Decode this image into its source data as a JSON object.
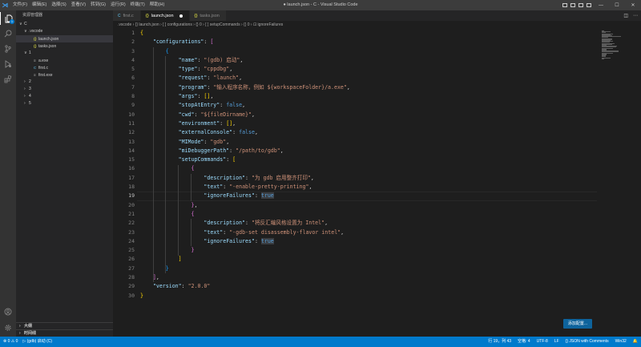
{
  "window": {
    "logo": "⋊",
    "title": "● launch.json - C - Visual Studio Code",
    "menu": [
      "文件(F)",
      "编辑(E)",
      "选择(S)",
      "查看(V)",
      "转到(G)",
      "运行(R)",
      "终端(T)",
      "帮助(H)"
    ],
    "controls": {
      "minimize": "—",
      "maximize": "☐",
      "close": "✕"
    }
  },
  "activity_bar": {
    "items": [
      "explorer-icon",
      "search-icon",
      "source-control-icon",
      "run-debug-icon",
      "extensions-icon"
    ],
    "badge": "1",
    "bottom": [
      "account-icon",
      "settings-icon"
    ]
  },
  "sidebar": {
    "title": "资源管理器",
    "tree": [
      {
        "label": "C",
        "chevron": "∨",
        "indent": 0,
        "icon": ""
      },
      {
        "label": ".vscode",
        "chevron": "∨",
        "indent": 1,
        "icon": ""
      },
      {
        "label": "launch.json",
        "chevron": "",
        "indent": 2,
        "icon": "{}",
        "selected": true
      },
      {
        "label": "tasks.json",
        "chevron": "",
        "indent": 2,
        "icon": "{}"
      },
      {
        "label": "1",
        "chevron": "∨",
        "indent": 1,
        "icon": ""
      },
      {
        "label": "a.exe",
        "chevron": "",
        "indent": 2,
        "icon": "≡"
      },
      {
        "label": "first.c",
        "chevron": "",
        "indent": 2,
        "icon": "C"
      },
      {
        "label": "first.exe",
        "chevron": "",
        "indent": 2,
        "icon": "≡"
      },
      {
        "label": "2",
        "chevron": "›",
        "indent": 1,
        "icon": ""
      },
      {
        "label": "3",
        "chevron": "›",
        "indent": 1,
        "icon": ""
      },
      {
        "label": "4",
        "chevron": "›",
        "indent": 1,
        "icon": ""
      },
      {
        "label": "5",
        "chevron": "›",
        "indent": 1,
        "icon": ""
      }
    ],
    "sections": [
      "大纲",
      "时间线"
    ]
  },
  "tabs": [
    {
      "label": "first.c",
      "icon": "C",
      "active": false
    },
    {
      "label": "launch.json",
      "icon": "{}",
      "active": true,
      "modified": true
    },
    {
      "label": "tasks.json",
      "icon": "{}",
      "active": false
    }
  ],
  "breadcrumb": ".vscode  ›  {} launch.json  ›  [ ] configurations  ›  {} 0  ›  [ ] setupCommands  ›  {} 0  ›  ⊡ ignoreFailures",
  "editor": {
    "current_line": 19,
    "lines": [
      [
        [
          "br1",
          "{"
        ]
      ],
      [
        [
          "p",
          "    "
        ],
        [
          "k",
          "\"configurations\""
        ],
        [
          "p",
          ": "
        ],
        [
          "br2",
          "["
        ]
      ],
      [
        [
          "p",
          "        "
        ],
        [
          "br3",
          "{"
        ]
      ],
      [
        [
          "p",
          "            "
        ],
        [
          "k",
          "\"name\""
        ],
        [
          "p",
          ": "
        ],
        [
          "s",
          "\"(gdb) 启动\""
        ],
        [
          "p",
          ","
        ]
      ],
      [
        [
          "p",
          "            "
        ],
        [
          "k",
          "\"type\""
        ],
        [
          "p",
          ": "
        ],
        [
          "s",
          "\"cppdbg\""
        ],
        [
          "p",
          ","
        ]
      ],
      [
        [
          "p",
          "            "
        ],
        [
          "k",
          "\"request\""
        ],
        [
          "p",
          ": "
        ],
        [
          "s",
          "\"launch\""
        ],
        [
          "p",
          ","
        ]
      ],
      [
        [
          "p",
          "            "
        ],
        [
          "k",
          "\"program\""
        ],
        [
          "p",
          ": "
        ],
        [
          "s",
          "\"输入程序名称，例如 ${workspaceFolder}/a.exe\""
        ],
        [
          "p",
          ","
        ]
      ],
      [
        [
          "p",
          "            "
        ],
        [
          "k",
          "\"args\""
        ],
        [
          "p",
          ": "
        ],
        [
          "br1",
          "[]"
        ],
        [
          "p",
          ","
        ]
      ],
      [
        [
          "p",
          "            "
        ],
        [
          "k",
          "\"stopAtEntry\""
        ],
        [
          "p",
          ": "
        ],
        [
          "b",
          "false"
        ],
        [
          "p",
          ","
        ]
      ],
      [
        [
          "p",
          "            "
        ],
        [
          "k",
          "\"cwd\""
        ],
        [
          "p",
          ": "
        ],
        [
          "s",
          "\"${fileDirname}\""
        ],
        [
          "p",
          ","
        ]
      ],
      [
        [
          "p",
          "            "
        ],
        [
          "k",
          "\"environment\""
        ],
        [
          "p",
          ": "
        ],
        [
          "br1",
          "[]"
        ],
        [
          "p",
          ","
        ]
      ],
      [
        [
          "p",
          "            "
        ],
        [
          "k",
          "\"externalConsole\""
        ],
        [
          "p",
          ": "
        ],
        [
          "b",
          "false"
        ],
        [
          "p",
          ","
        ]
      ],
      [
        [
          "p",
          "            "
        ],
        [
          "k",
          "\"MIMode\""
        ],
        [
          "p",
          ": "
        ],
        [
          "s",
          "\"gdb\""
        ],
        [
          "p",
          ","
        ]
      ],
      [
        [
          "p",
          "            "
        ],
        [
          "k",
          "\"miDebuggerPath\""
        ],
        [
          "p",
          ": "
        ],
        [
          "s",
          "\"/path/to/gdb\""
        ],
        [
          "p",
          ","
        ]
      ],
      [
        [
          "p",
          "            "
        ],
        [
          "k",
          "\"setupCommands\""
        ],
        [
          "p",
          ": "
        ],
        [
          "br1",
          "["
        ]
      ],
      [
        [
          "p",
          "                "
        ],
        [
          "br2",
          "{"
        ]
      ],
      [
        [
          "p",
          "                    "
        ],
        [
          "k",
          "\"description\""
        ],
        [
          "p",
          ": "
        ],
        [
          "s",
          "\"为 gdb 启用整齐打印\""
        ],
        [
          "p",
          ","
        ]
      ],
      [
        [
          "p",
          "                    "
        ],
        [
          "k",
          "\"text\""
        ],
        [
          "p",
          ": "
        ],
        [
          "s",
          "\"-enable-pretty-printing\""
        ],
        [
          "p",
          ","
        ]
      ],
      [
        [
          "p",
          "                    "
        ],
        [
          "k",
          "\"ignoreFailures\""
        ],
        [
          "p",
          ": "
        ],
        [
          "b",
          "true"
        ]
      ],
      [
        [
          "p",
          "                "
        ],
        [
          "br2",
          "}"
        ],
        [
          "p",
          ","
        ]
      ],
      [
        [
          "p",
          "                "
        ],
        [
          "br2",
          "{"
        ]
      ],
      [
        [
          "p",
          "                    "
        ],
        [
          "k",
          "\"description\""
        ],
        [
          "p",
          ": "
        ],
        [
          "s",
          "\"将反汇编风格设置为 Intel\""
        ],
        [
          "p",
          ","
        ]
      ],
      [
        [
          "p",
          "                    "
        ],
        [
          "k",
          "\"text\""
        ],
        [
          "p",
          ": "
        ],
        [
          "s",
          "\"-gdb-set disassembly-flavor intel\""
        ],
        [
          "p",
          ","
        ]
      ],
      [
        [
          "p",
          "                    "
        ],
        [
          "k",
          "\"ignoreFailures\""
        ],
        [
          "p",
          ": "
        ],
        [
          "b",
          "true"
        ]
      ],
      [
        [
          "p",
          "                "
        ],
        [
          "br2",
          "}"
        ]
      ],
      [
        [
          "p",
          "            "
        ],
        [
          "br1",
          "]"
        ]
      ],
      [
        [
          "p",
          "        "
        ],
        [
          "br3",
          "}"
        ]
      ],
      [
        [
          "p",
          "    "
        ],
        [
          "br2",
          "]"
        ],
        [
          "p",
          ","
        ]
      ],
      [
        [
          "p",
          "    "
        ],
        [
          "k",
          "\"version\""
        ],
        [
          "p",
          ": "
        ],
        [
          "s",
          "\"2.0.0\""
        ]
      ],
      [
        [
          "br1",
          "}"
        ]
      ]
    ]
  },
  "notification_button": "添加配置...",
  "statusbar": {
    "left": [
      "⊗ 0  ⚠ 0",
      "▷ (gdb) 启动 (C)"
    ],
    "right": [
      "行 19，列 43",
      "空格: 4",
      "UTF-8",
      "LF",
      "{} JSON with Comments",
      "Win32",
      "🔔"
    ]
  },
  "colors": {
    "accent": "#007acc",
    "titlebar": "#3c3c3c",
    "activitybar": "#333333",
    "sidebar": "#252526",
    "editor": "#1e1e1e"
  }
}
